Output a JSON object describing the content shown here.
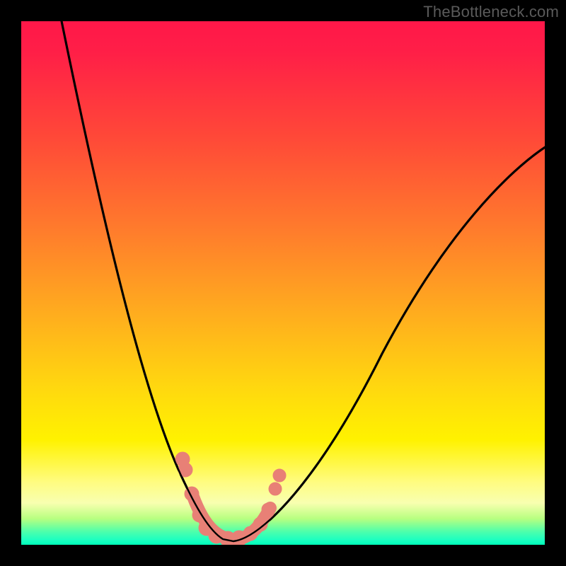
{
  "watermark": "TheBottleneck.com",
  "chart_data": {
    "type": "line",
    "title": "",
    "xlabel": "",
    "ylabel": "",
    "xlim": [
      0,
      100
    ],
    "ylim": [
      0,
      100
    ],
    "grid": false,
    "legend": false,
    "background_gradient": {
      "stops": [
        {
          "pct": 0,
          "color": "#ff1749"
        },
        {
          "pct": 22,
          "color": "#ff4838"
        },
        {
          "pct": 40,
          "color": "#ff7c2c"
        },
        {
          "pct": 56,
          "color": "#ffad1e"
        },
        {
          "pct": 70,
          "color": "#ffd80f"
        },
        {
          "pct": 80,
          "color": "#fff200"
        },
        {
          "pct": 88,
          "color": "#fffc80"
        },
        {
          "pct": 95,
          "color": "#b8ff80"
        },
        {
          "pct": 100,
          "color": "#00ffba"
        }
      ]
    },
    "series": [
      {
        "name": "bottleneck-curve",
        "color": "#000000",
        "x": [
          7,
          9,
          12,
          15,
          18,
          21,
          24,
          26,
          28,
          30,
          32,
          34,
          36,
          38,
          40,
          42,
          46,
          50,
          55,
          60,
          66,
          72,
          80,
          90,
          100
        ],
        "y": [
          100,
          90,
          78,
          66,
          56,
          46,
          37,
          30,
          23,
          16,
          10,
          5,
          1,
          0,
          0,
          1,
          4,
          9,
          16,
          24,
          34,
          44,
          56,
          68,
          75
        ]
      }
    ],
    "markers": {
      "name": "highlight-dots",
      "color": "#e88076",
      "points": [
        {
          "x": 30,
          "y": 16
        },
        {
          "x": 31,
          "y": 12
        },
        {
          "x": 32,
          "y": 6
        },
        {
          "x": 34,
          "y": 3
        },
        {
          "x": 36,
          "y": 1
        },
        {
          "x": 38,
          "y": 0.6
        },
        {
          "x": 40,
          "y": 0.8
        },
        {
          "x": 42,
          "y": 1.5
        },
        {
          "x": 44,
          "y": 3
        },
        {
          "x": 46,
          "y": 6
        },
        {
          "x": 48,
          "y": 10
        },
        {
          "x": 49,
          "y": 14
        }
      ]
    }
  }
}
